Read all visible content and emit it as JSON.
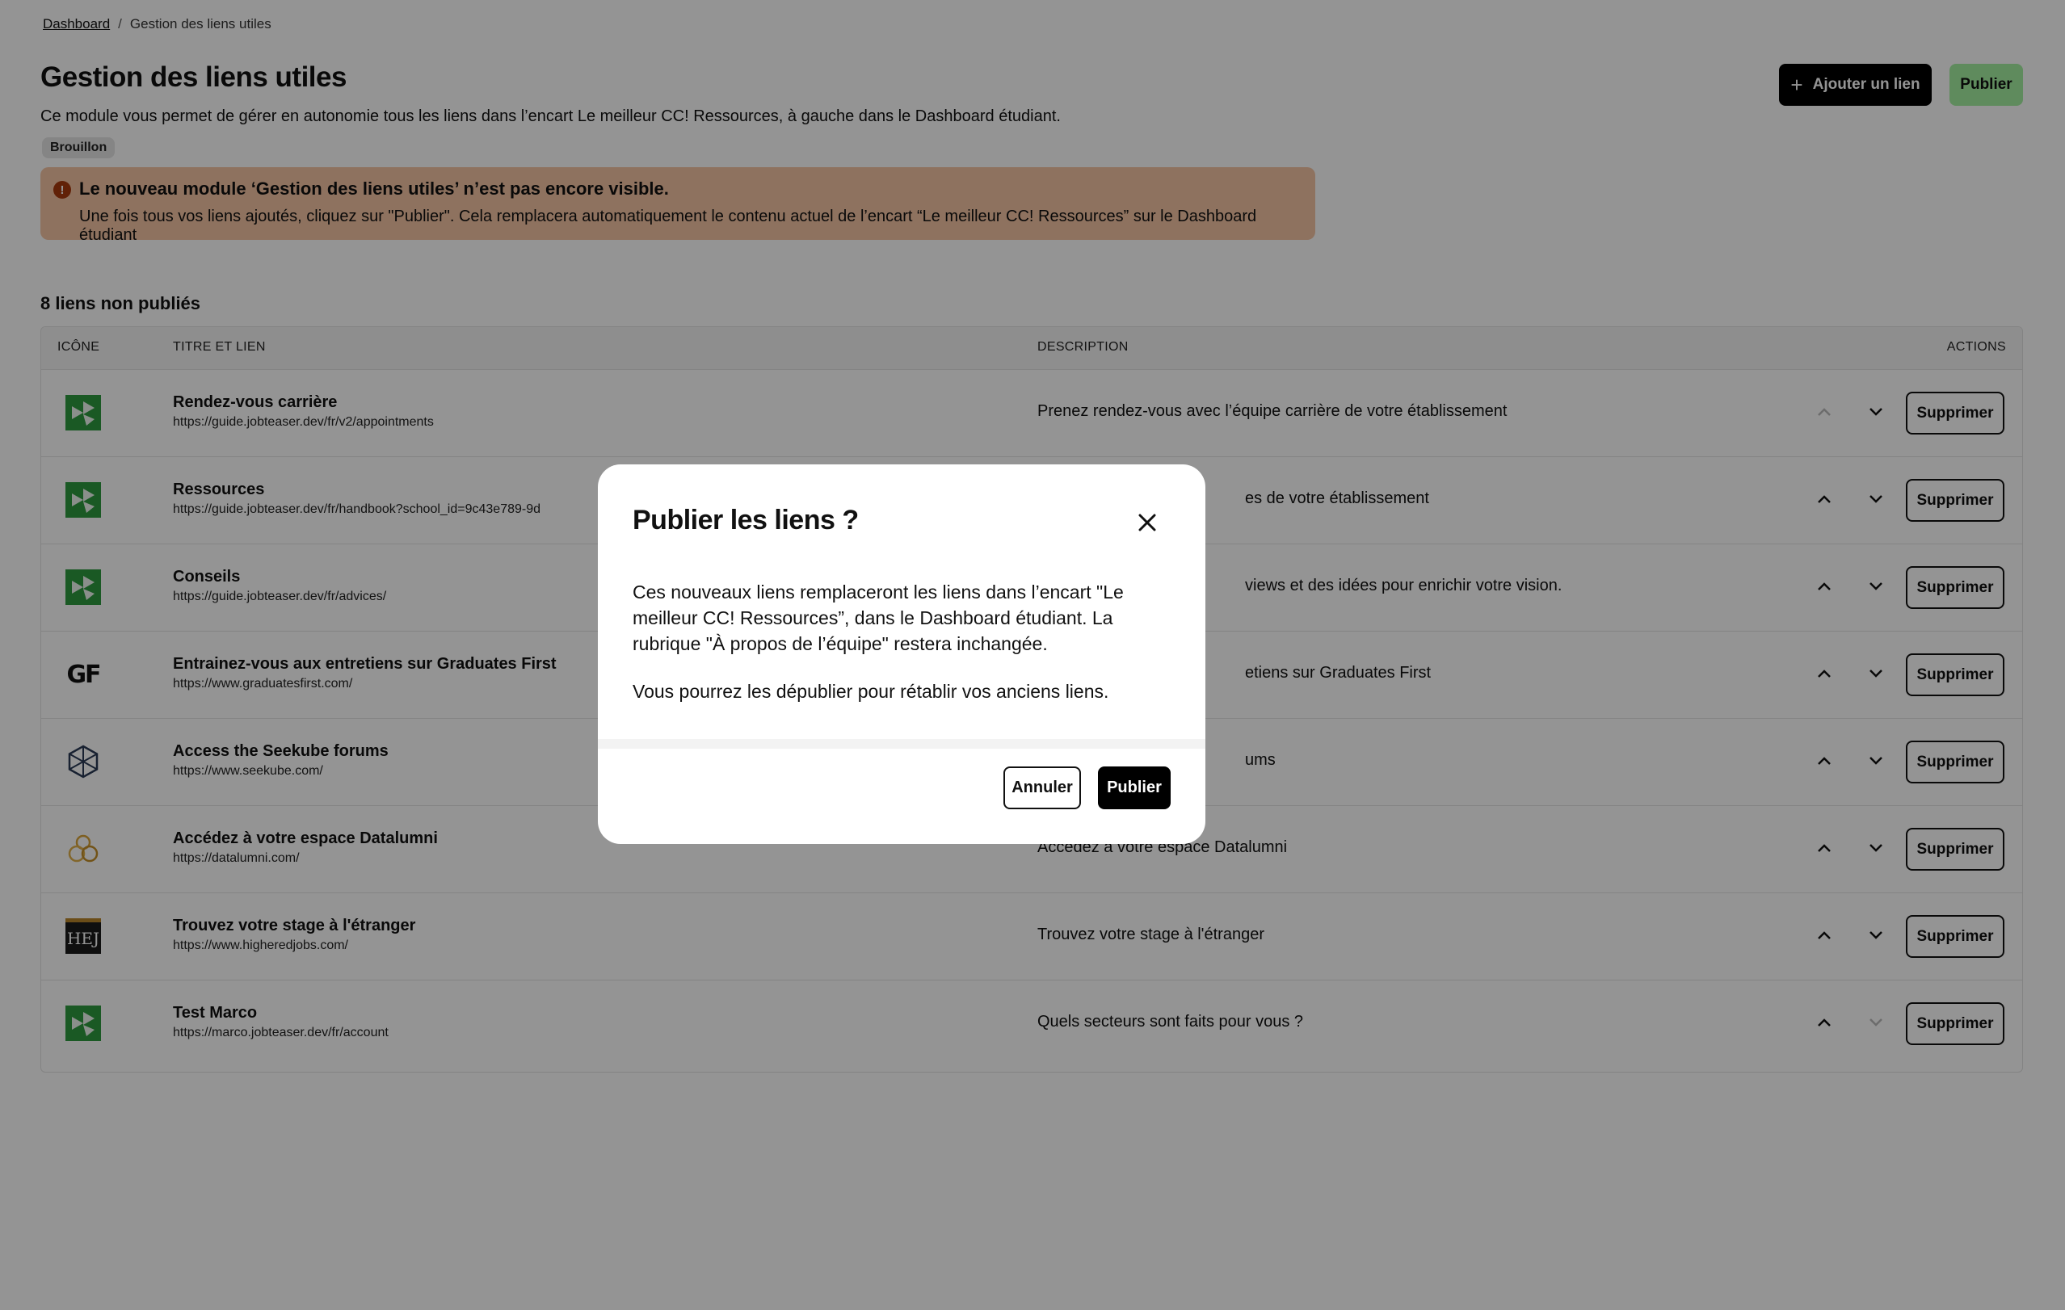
{
  "breadcrumb": {
    "home": "Dashboard",
    "separator": "/",
    "current": "Gestion des liens utiles"
  },
  "header": {
    "title": "Gestion des liens utiles",
    "subtitle": "Ce module vous permet de gérer en autonomie tous les liens dans l’encart Le meilleur CC! Ressources, à gauche dans le Dashboard étudiant.",
    "status_badge": "Brouillon",
    "add_button": "Ajouter un lien",
    "add_icon": "+",
    "publish_button": "Publier"
  },
  "warning": {
    "icon": "!",
    "title": "Le nouveau module ‘Gestion des liens utiles’ n’est pas encore visible.",
    "text": "Une fois tous vos liens ajoutés, cliquez sur \"Publier\". Cela remplacera automatiquement le contenu actuel de l’encart “Le meilleur CC! Ressources” sur le Dashboard étudiant"
  },
  "table": {
    "count_label": "8 liens non publiés",
    "headers": {
      "icon": "ICÔNE",
      "title": "TITRE ET LIEN",
      "description": "DESCRIPTION",
      "actions": "ACTIONS"
    },
    "delete_label": "Supprimer",
    "rows": [
      {
        "icon": "jobteaser-icon",
        "title": "Rendez-vous carrière",
        "url": "https://guide.jobteaser.dev/fr/v2/appointments",
        "description": "Prenez rendez-vous avec l’équipe carrière de votre établissement"
      },
      {
        "icon": "jobteaser-icon",
        "title": "Ressources",
        "url": "https://guide.jobteaser.dev/fr/handbook?school_id=9c43e789-9d",
        "description": "es de votre établissement"
      },
      {
        "icon": "jobteaser-icon",
        "title": "Conseils",
        "url": "https://guide.jobteaser.dev/fr/advices/",
        "description": "views et des idées pour enrichir votre vision."
      },
      {
        "icon": "graduates-first-icon",
        "logo_text": "GF",
        "title": "Entrainez-vous aux entretiens sur Graduates First",
        "url": "https://www.graduatesfirst.com/",
        "description": "etiens sur Graduates First"
      },
      {
        "icon": "seekube-icon",
        "title": "Access the Seekube forums",
        "url": "https://www.seekube.com/",
        "description": "ums"
      },
      {
        "icon": "datalumni-icon",
        "title": "Accédez à votre espace Datalumni",
        "url": "https://datalumni.com/",
        "description": "Accédez à votre espace Datalumni"
      },
      {
        "icon": "higheredjobs-icon",
        "logo_text": "HEJ",
        "title": "Trouvez votre stage à l'étranger",
        "url": "https://www.higheredjobs.com/",
        "description": "Trouvez votre stage à l'étranger"
      },
      {
        "icon": "jobteaser-icon",
        "title": "Test Marco",
        "url": "https://marco.jobteaser.dev/fr/account",
        "description": "Quels secteurs sont faits pour vous ?"
      }
    ]
  },
  "modal": {
    "title": "Publier les liens ?",
    "paragraph1": "Ces nouveaux liens remplaceront les liens dans l’encart \"Le meilleur CC! Ressources”, dans le Dashboard étudiant. La rubrique \"À propos de l’équipe\" restera inchangée.",
    "paragraph2": "Vous pourrez les dépublier pour rétablir vos anciens liens.",
    "cancel_button": "Annuler",
    "publish_button": "Publier"
  },
  "colors": {
    "accent_publish": "#a4f0a0",
    "warning_bg": "#f5c4a4",
    "warning_icon": "#a8390d",
    "jobteaser_green": "#2e9a3f"
  }
}
